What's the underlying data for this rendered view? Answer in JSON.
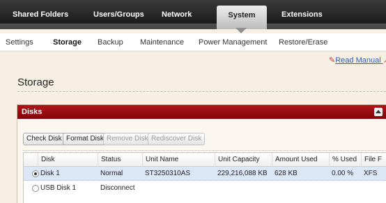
{
  "topnav": {
    "items": [
      {
        "label": "Shared Folders",
        "active": false
      },
      {
        "label": "Users/Groups",
        "active": false
      },
      {
        "label": "Network",
        "active": false
      },
      {
        "label": "System",
        "active": true
      },
      {
        "label": "Extensions",
        "active": false
      }
    ]
  },
  "subnav": {
    "items": [
      {
        "label": "Settings",
        "active": false
      },
      {
        "label": "Storage",
        "active": true
      },
      {
        "label": "Backup",
        "active": false
      },
      {
        "label": "Maintenance",
        "active": false
      },
      {
        "label": "Power Management",
        "active": false
      },
      {
        "label": "Restore/Erase",
        "active": false
      }
    ]
  },
  "manual": {
    "label": "Read Manual",
    "icon": "external-link-icon",
    "trail": "F"
  },
  "page": {
    "title": "Storage"
  },
  "panel": {
    "title": "Disks",
    "collapse_icon": "collapse-up-icon",
    "buttons": [
      {
        "label": "Check Disk",
        "enabled": true
      },
      {
        "label": "Format Disk",
        "enabled": true
      },
      {
        "label": "Remove Disk",
        "enabled": false
      },
      {
        "label": "Rediscover Disk",
        "enabled": false
      }
    ]
  },
  "table": {
    "columns": [
      "Disk",
      "Status",
      "Unit Name",
      "Unit Capacity",
      "Amount Used",
      "% Used",
      "File F"
    ],
    "rows": [
      {
        "selected": true,
        "cells": [
          "Disk 1",
          "Normal",
          "ST3250310AS",
          "229,216,088 KB",
          "628 KB",
          "0.00 %",
          "XFS"
        ]
      },
      {
        "selected": false,
        "cells": [
          "USB Disk 1",
          "Disconnect",
          "",
          "",
          "",
          "",
          ""
        ]
      }
    ]
  },
  "colors": {
    "accent": "#8b0d0f",
    "selection": "#dbe6f7",
    "background": "#f6efe3"
  }
}
